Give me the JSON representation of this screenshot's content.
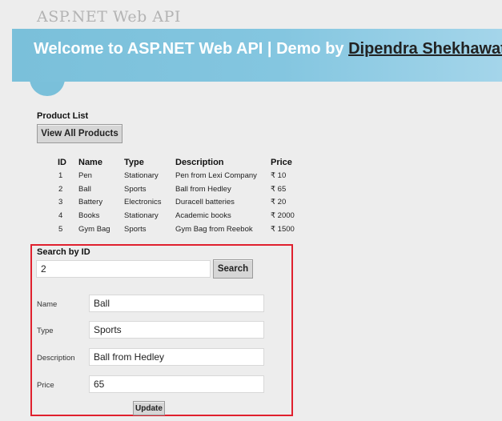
{
  "header": {
    "site_title": "ASP.NET Web API",
    "banner_prefix": "Welcome to ASP.NET Web API | Demo by ",
    "banner_author": "Dipendra Shekhawat",
    "banner_color": "#7ac0da"
  },
  "product_list": {
    "heading": "Product List",
    "view_all_label": "View All Products",
    "columns": [
      "ID",
      "Name",
      "Type",
      "Description",
      "Price"
    ],
    "rows": [
      [
        "1",
        "Pen",
        "Stationary",
        "Pen from Lexi Company",
        "₹ 10"
      ],
      [
        "2",
        "Ball",
        "Sports",
        "Ball from Hedley",
        "₹ 65"
      ],
      [
        "3",
        "Battery",
        "Electronics",
        "Duracell batteries",
        "₹ 20"
      ],
      [
        "4",
        "Books",
        "Stationary",
        "Academic books",
        "₹ 2000"
      ],
      [
        "5",
        "Gym Bag",
        "Sports",
        "Gym Bag from Reebok",
        "₹ 1500"
      ]
    ]
  },
  "search": {
    "heading": "Search by ID",
    "id_value": "2",
    "search_label": "Search",
    "highlight_color": "#e0202e"
  },
  "detail": {
    "name_label": "Name",
    "name_value": "Ball",
    "type_label": "Type",
    "type_value": "Sports",
    "description_label": "Description",
    "description_value": "Ball from Hedley",
    "price_label": "Price",
    "price_value": "65",
    "update_label": "Update"
  }
}
